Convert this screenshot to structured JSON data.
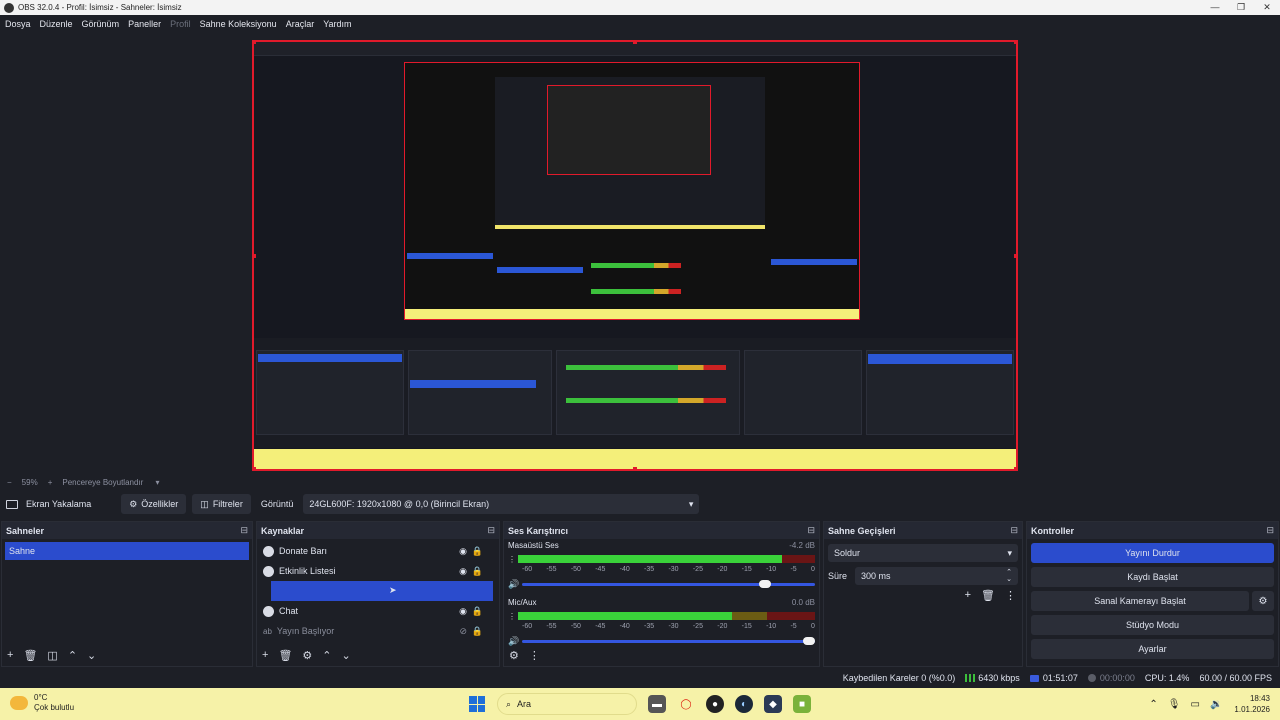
{
  "window": {
    "title": "OBS 32.0.4 - Profil: İsimsiz - Sahneler: İsimsiz"
  },
  "menu": [
    {
      "label": "Dosya",
      "disabled": false
    },
    {
      "label": "Düzenle",
      "disabled": false
    },
    {
      "label": "Görünüm",
      "disabled": false
    },
    {
      "label": "Paneller",
      "disabled": false
    },
    {
      "label": "Profil",
      "disabled": true
    },
    {
      "label": "Sahne Koleksiyonu",
      "disabled": false
    },
    {
      "label": "Araçlar",
      "disabled": false
    },
    {
      "label": "Yardım",
      "disabled": false
    }
  ],
  "zoom": {
    "minus": "−",
    "value": "59%",
    "plus": "+",
    "fit": "Pencereye Boyutlandır"
  },
  "source_bar": {
    "source_name": "Ekran Yakalama",
    "properties": "Özellikler",
    "filters": "Filtreler",
    "display_label": "Görüntü",
    "display_value": "24GL600F: 1920x1080 @ 0,0 (Birincil Ekran)"
  },
  "scenes": {
    "title": "Sahneler",
    "items": [
      "Sahne"
    ]
  },
  "sources": {
    "title": "Kaynaklar",
    "items": [
      "Donate Barı",
      "Etkinlik Listesi",
      "Chat",
      "Yayın Başlıyor"
    ]
  },
  "mixer": {
    "title": "Ses Karıştırıcı",
    "ticks": [
      "-60",
      "-55",
      "-50",
      "-45",
      "-40",
      "-35",
      "-30",
      "-25",
      "-20",
      "-15",
      "-10",
      "-5",
      "0"
    ],
    "channels": [
      {
        "name": "Masaüstü Ses",
        "db": "-4.2 dB",
        "level": 0.89,
        "volume": 0.85
      },
      {
        "name": "Mic/Aux",
        "db": "0.0 dB",
        "level": 0.72,
        "volume": 1.0
      }
    ]
  },
  "transitions": {
    "title": "Sahne Geçişleri",
    "type": "Soldur",
    "duration_label": "Süre",
    "duration": "300 ms"
  },
  "controls": {
    "title": "Kontroller",
    "stop_stream": "Yayını Durdur",
    "start_recording": "Kaydı Başlat",
    "start_virtualcam": "Sanal Kamerayı Başlat",
    "studio_mode": "Stüdyo Modu",
    "settings": "Ayarlar"
  },
  "status": {
    "dropped": "Kaybedilen Kareler 0 (%0.0)",
    "bitrate": "6430 kbps",
    "stream_time": "01:51:07",
    "rec_time": "00:00:00",
    "cpu": "CPU: 1.4%",
    "fps": "60.00 / 60.00 FPS"
  },
  "taskbar": {
    "temp": "0°C",
    "weather": "Çok bulutlu",
    "search": "Ara",
    "time": "18:43",
    "date": "1.01.2026"
  },
  "colors": {
    "accent": "#2b4ccd",
    "preview_border": "#e11a2b",
    "taskbar": "#f6f2a8"
  }
}
